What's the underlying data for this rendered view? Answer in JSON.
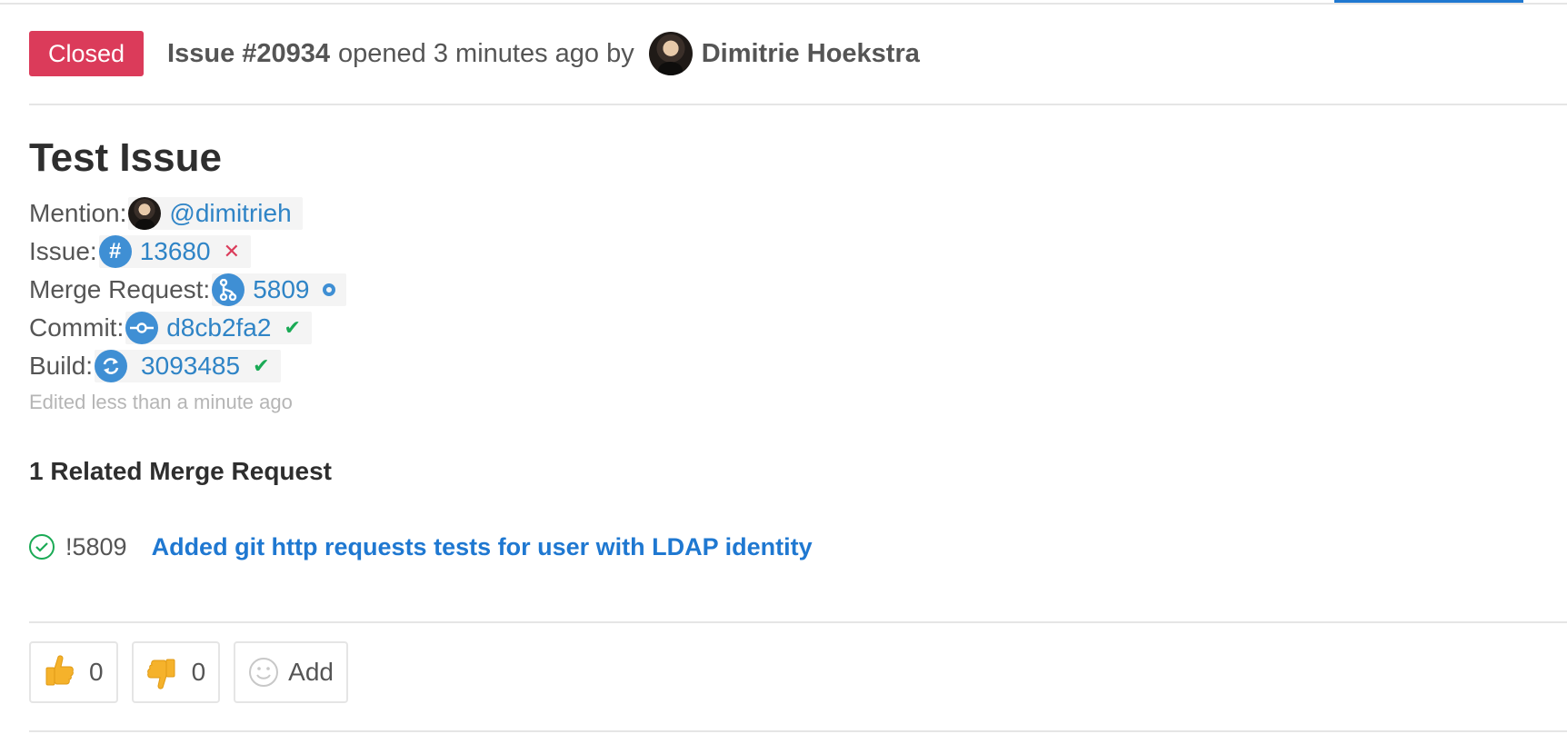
{
  "colors": {
    "closed_badge": "#db3b5a",
    "link": "#2f84c6",
    "accent_tab": "#1f78d1",
    "success": "#1aaa55"
  },
  "header": {
    "state": "Closed",
    "issue_ref": "Issue #20934",
    "opened_text": "opened 3 minutes ago by",
    "author": "Dimitrie Hoekstra"
  },
  "issue": {
    "title": "Test Issue",
    "edited": "Edited less than a minute ago"
  },
  "refs": {
    "mention": {
      "label": "Mention:",
      "value": "@dimitrieh",
      "icon": "avatar"
    },
    "issue": {
      "label": "Issue:",
      "value": "13680",
      "icon": "hash-icon",
      "status": "closed",
      "status_icon": "x-icon"
    },
    "merge_request": {
      "label": "Merge Request:",
      "value": "5809",
      "icon": "merge-request-icon",
      "status": "open",
      "status_icon": "open-circle-icon"
    },
    "commit": {
      "label": "Commit:",
      "value": "d8cb2fa2",
      "icon": "commit-icon",
      "status": "success",
      "status_icon": "check-icon"
    },
    "build": {
      "label": "Build:",
      "value": "3093485",
      "icon": "build-icon",
      "status": "success",
      "status_icon": "check-icon"
    }
  },
  "related": {
    "heading": "1 Related Merge Request",
    "items": [
      {
        "status_icon": "check-circle-icon",
        "ref": "!5809",
        "title": "Added git http requests tests for user with LDAP identity"
      }
    ]
  },
  "awards": {
    "thumbs_up": {
      "emoji": "thumbs-up-icon",
      "count": "0"
    },
    "thumbs_down": {
      "emoji": "thumbs-down-icon",
      "count": "0"
    },
    "add": {
      "icon": "smiley-icon",
      "label": "Add"
    }
  }
}
